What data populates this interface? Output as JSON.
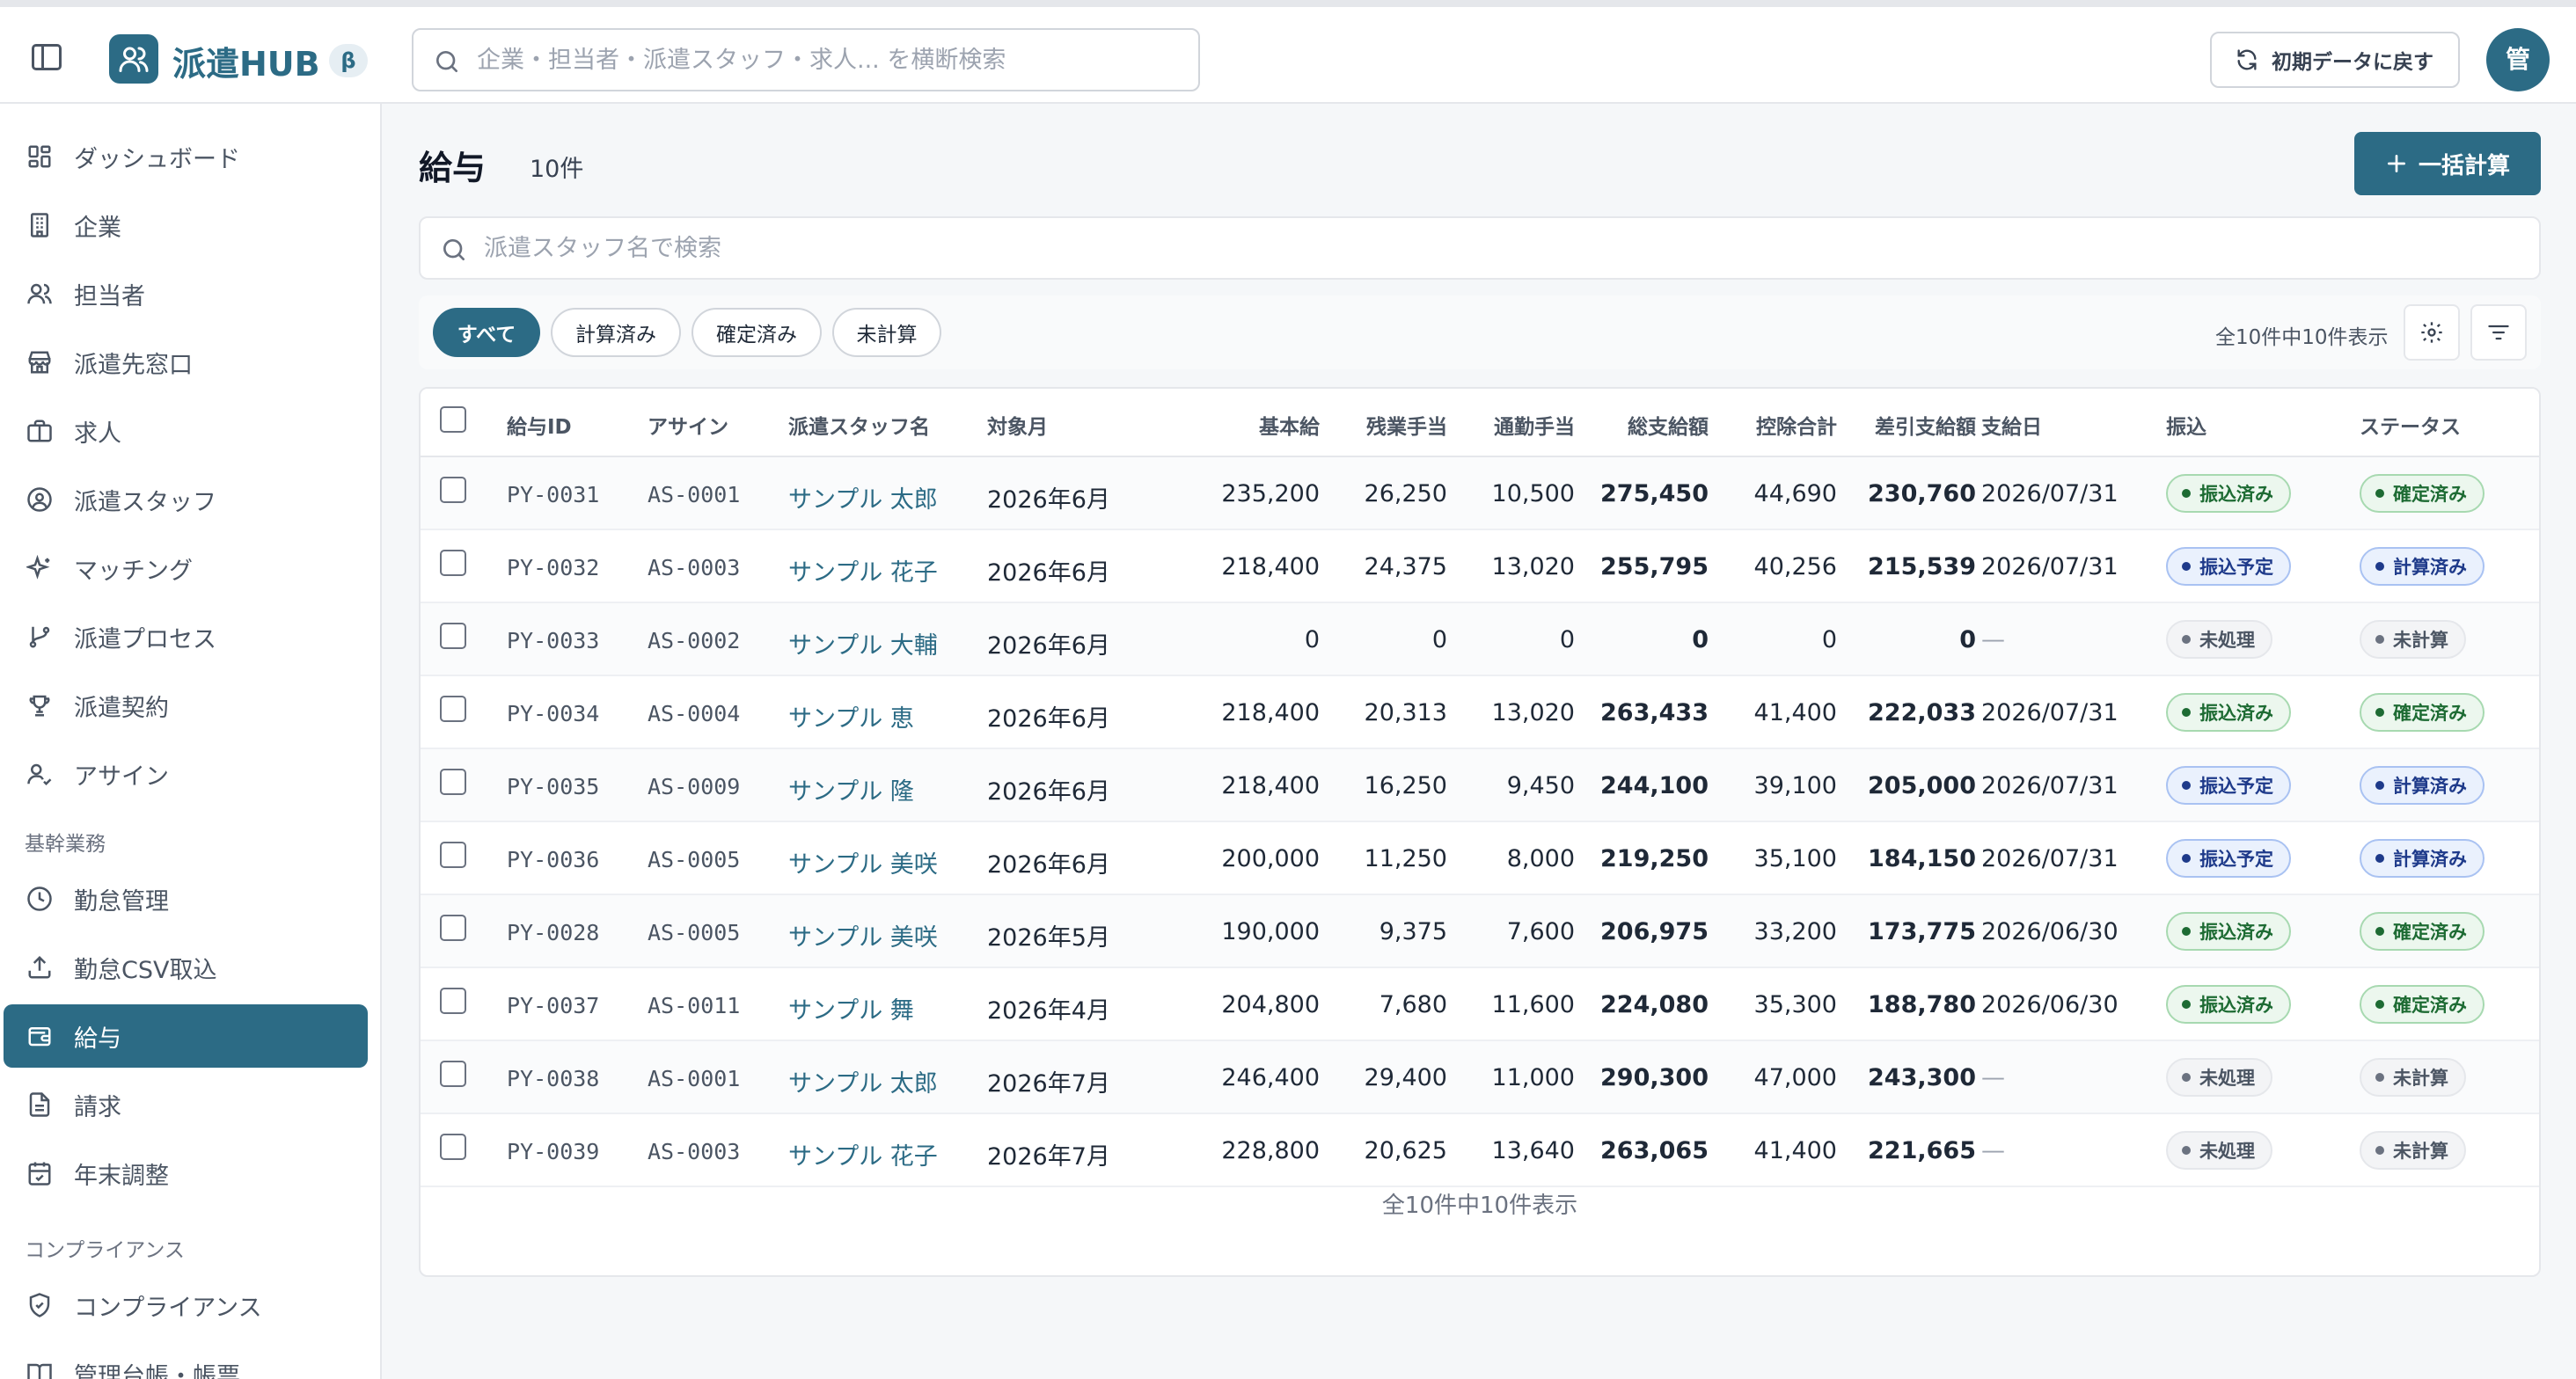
{
  "app": {
    "title": "派遣HUB",
    "beta": "β"
  },
  "header": {
    "search_placeholder": "企業・担当者・派遣スタッフ・求人... を横断検索",
    "reset_label": "初期データに戻す",
    "avatar_label": "管"
  },
  "sidebar": {
    "items": [
      {
        "label": "ダッシュボード",
        "icon": "dashboard-icon"
      },
      {
        "label": "企業",
        "icon": "building-icon"
      },
      {
        "label": "担当者",
        "icon": "users-icon"
      },
      {
        "label": "派遣先窓口",
        "icon": "store-icon"
      },
      {
        "label": "求人",
        "icon": "briefcase-icon"
      },
      {
        "label": "派遣スタッフ",
        "icon": "user-circle-icon"
      },
      {
        "label": "マッチング",
        "icon": "sparkles-icon"
      },
      {
        "label": "派遣プロセス",
        "icon": "git-branch-icon"
      },
      {
        "label": "派遣契約",
        "icon": "trophy-icon"
      },
      {
        "label": "アサイン",
        "icon": "user-check-icon"
      }
    ],
    "section_core": "基幹業務",
    "core_items": [
      {
        "label": "勤怠管理",
        "icon": "clock-icon"
      },
      {
        "label": "勤怠CSV取込",
        "icon": "upload-icon"
      },
      {
        "label": "給与",
        "icon": "wallet-icon",
        "active": true
      },
      {
        "label": "請求",
        "icon": "document-icon"
      },
      {
        "label": "年末調整",
        "icon": "calendar-check-icon"
      }
    ],
    "section_compliance": "コンプライアンス",
    "compliance_items": [
      {
        "label": "コンプライアンス",
        "icon": "shield-icon"
      },
      {
        "label": "管理台帳・帳票",
        "icon": "book-icon"
      }
    ]
  },
  "page": {
    "title": "給与",
    "count": "10件",
    "bulk_button": "一括計算",
    "search_placeholder": "派遣スタッフ名で検索",
    "filters": [
      "すべて",
      "計算済み",
      "確定済み",
      "未計算"
    ],
    "active_filter": "すべて",
    "summary": "全10件中10件表示",
    "footer": "全10件中10件表示"
  },
  "table": {
    "columns": [
      "給与ID",
      "アサイン",
      "派遣スタッフ名",
      "対象月",
      "基本給",
      "残業手当",
      "通勤手当",
      "総支給額",
      "控除合計",
      "差引支給額",
      "支給日",
      "振込",
      "ステータス"
    ],
    "rows": [
      {
        "id": "PY-0031",
        "assign": "AS-0001",
        "staff": "サンプル 太郎",
        "month": "2026年6月",
        "base": "235,200",
        "overtime": "26,250",
        "commute": "10,500",
        "gross": "275,450",
        "deduct": "44,690",
        "net": "230,760",
        "paydate": "2026/07/31",
        "transfer": "振込済み",
        "transfer_kind": "green",
        "status": "確定済み",
        "status_kind": "green"
      },
      {
        "id": "PY-0032",
        "assign": "AS-0003",
        "staff": "サンプル 花子",
        "month": "2026年6月",
        "base": "218,400",
        "overtime": "24,375",
        "commute": "13,020",
        "gross": "255,795",
        "deduct": "40,256",
        "net": "215,539",
        "paydate": "2026/07/31",
        "transfer": "振込予定",
        "transfer_kind": "blue",
        "status": "計算済み",
        "status_kind": "blue"
      },
      {
        "id": "PY-0033",
        "assign": "AS-0002",
        "staff": "サンプル 大輔",
        "month": "2026年6月",
        "base": "0",
        "overtime": "0",
        "commute": "0",
        "gross": "0",
        "deduct": "0",
        "net": "0",
        "paydate": "—",
        "transfer": "未処理",
        "transfer_kind": "gray",
        "status": "未計算",
        "status_kind": "gray"
      },
      {
        "id": "PY-0034",
        "assign": "AS-0004",
        "staff": "サンプル 恵",
        "month": "2026年6月",
        "base": "218,400",
        "overtime": "20,313",
        "commute": "13,020",
        "gross": "263,433",
        "deduct": "41,400",
        "net": "222,033",
        "paydate": "2026/07/31",
        "transfer": "振込済み",
        "transfer_kind": "green",
        "status": "確定済み",
        "status_kind": "green"
      },
      {
        "id": "PY-0035",
        "assign": "AS-0009",
        "staff": "サンプル 隆",
        "month": "2026年6月",
        "base": "218,400",
        "overtime": "16,250",
        "commute": "9,450",
        "gross": "244,100",
        "deduct": "39,100",
        "net": "205,000",
        "paydate": "2026/07/31",
        "transfer": "振込予定",
        "transfer_kind": "blue",
        "status": "計算済み",
        "status_kind": "blue"
      },
      {
        "id": "PY-0036",
        "assign": "AS-0005",
        "staff": "サンプル 美咲",
        "month": "2026年6月",
        "base": "200,000",
        "overtime": "11,250",
        "commute": "8,000",
        "gross": "219,250",
        "deduct": "35,100",
        "net": "184,150",
        "paydate": "2026/07/31",
        "transfer": "振込予定",
        "transfer_kind": "blue",
        "status": "計算済み",
        "status_kind": "blue"
      },
      {
        "id": "PY-0028",
        "assign": "AS-0005",
        "staff": "サンプル 美咲",
        "month": "2026年5月",
        "base": "190,000",
        "overtime": "9,375",
        "commute": "7,600",
        "gross": "206,975",
        "deduct": "33,200",
        "net": "173,775",
        "paydate": "2026/06/30",
        "transfer": "振込済み",
        "transfer_kind": "green",
        "status": "確定済み",
        "status_kind": "green"
      },
      {
        "id": "PY-0037",
        "assign": "AS-0011",
        "staff": "サンプル 舞",
        "month": "2026年4月",
        "base": "204,800",
        "overtime": "7,680",
        "commute": "11,600",
        "gross": "224,080",
        "deduct": "35,300",
        "net": "188,780",
        "paydate": "2026/06/30",
        "transfer": "振込済み",
        "transfer_kind": "green",
        "status": "確定済み",
        "status_kind": "green"
      },
      {
        "id": "PY-0038",
        "assign": "AS-0001",
        "staff": "サンプル 太郎",
        "month": "2026年7月",
        "base": "246,400",
        "overtime": "29,400",
        "commute": "11,000",
        "gross": "290,300",
        "deduct": "47,000",
        "net": "243,300",
        "paydate": "—",
        "transfer": "未処理",
        "transfer_kind": "gray",
        "status": "未計算",
        "status_kind": "gray"
      },
      {
        "id": "PY-0039",
        "assign": "AS-0003",
        "staff": "サンプル 花子",
        "month": "2026年7月",
        "base": "228,800",
        "overtime": "20,625",
        "commute": "13,640",
        "gross": "263,065",
        "deduct": "41,400",
        "net": "221,665",
        "paydate": "—",
        "transfer": "未処理",
        "transfer_kind": "gray",
        "status": "未計算",
        "status_kind": "gray"
      }
    ]
  },
  "colors": {
    "accent": "#2c6b85",
    "success": "#1d6b33",
    "info": "#1e3a8a",
    "muted": "#6b7280"
  }
}
